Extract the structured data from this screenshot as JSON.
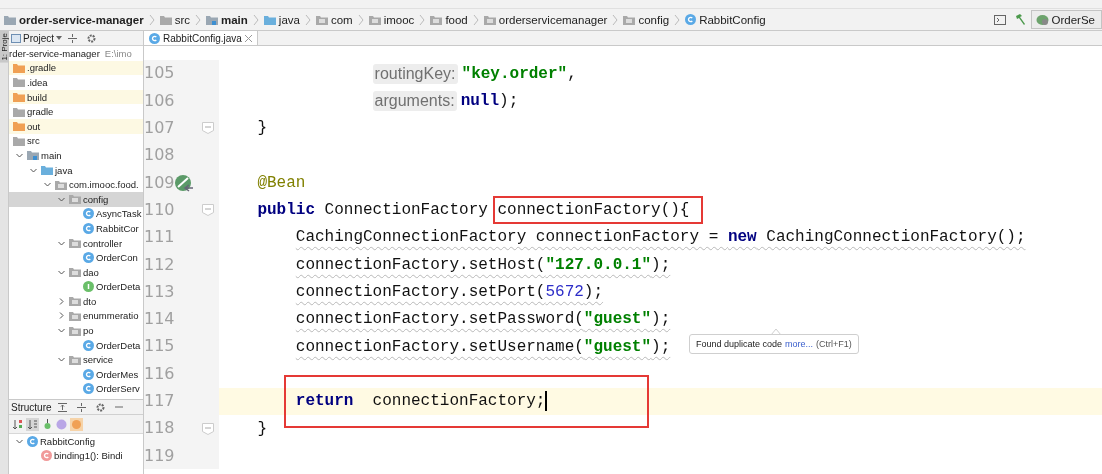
{
  "breadcrumbs": [
    {
      "label": "order-service-manager",
      "kind": "module",
      "bold": true
    },
    {
      "label": "src",
      "kind": "folder",
      "bold": false
    },
    {
      "label": "main",
      "kind": "source",
      "bold": true
    },
    {
      "label": "java",
      "kind": "java",
      "bold": false
    },
    {
      "label": "com",
      "kind": "package",
      "bold": false
    },
    {
      "label": "imooc",
      "kind": "package",
      "bold": false
    },
    {
      "label": "food",
      "kind": "package",
      "bold": false
    },
    {
      "label": "orderservicemanager",
      "kind": "package",
      "bold": false
    },
    {
      "label": "config",
      "kind": "package",
      "bold": false
    },
    {
      "label": "RabbitConfig",
      "kind": "class",
      "bold": false
    }
  ],
  "run_config": {
    "label": "OrderSe"
  },
  "side_strip": {
    "label": "1: Proje"
  },
  "project_panel": {
    "title": "Project",
    "root": {
      "label": "rder-service-manager",
      "path": "E:\\imo"
    },
    "tree": [
      {
        "label": ".gradle",
        "kind": "excluded",
        "selected": false
      },
      {
        "label": ".idea",
        "kind": "folder",
        "selected": false
      },
      {
        "label": "build",
        "kind": "excluded",
        "selected": false
      },
      {
        "label": "gradle",
        "kind": "folder",
        "selected": false
      },
      {
        "label": "out",
        "kind": "excluded",
        "selected": false
      },
      {
        "label": "src",
        "kind": "folder",
        "selected": false,
        "children": [
          {
            "label": "main",
            "kind": "source",
            "selected": false,
            "expanded": true,
            "children": [
              {
                "label": "java",
                "kind": "java",
                "selected": false,
                "expanded": true,
                "children": [
                  {
                    "label": "com.imooc.food.",
                    "kind": "package",
                    "selected": false,
                    "expanded": true,
                    "children": [
                      {
                        "label": "config",
                        "kind": "package",
                        "selected": true,
                        "expanded": true,
                        "children": [
                          {
                            "label": "AsyncTask",
                            "kind": "class",
                            "selected": false
                          },
                          {
                            "label": "RabbitCor",
                            "kind": "class",
                            "selected": false
                          }
                        ]
                      },
                      {
                        "label": "controller",
                        "kind": "package",
                        "selected": false,
                        "expanded": true,
                        "children": [
                          {
                            "label": "OrderCon",
                            "kind": "class",
                            "selected": false
                          }
                        ]
                      },
                      {
                        "label": "dao",
                        "kind": "package",
                        "selected": false,
                        "expanded": true,
                        "children": [
                          {
                            "label": "OrderDeta",
                            "kind": "interface",
                            "selected": false
                          }
                        ]
                      },
                      {
                        "label": "dto",
                        "kind": "package",
                        "selected": false,
                        "expanded": false
                      },
                      {
                        "label": "enummeratio",
                        "kind": "package",
                        "selected": false,
                        "expanded": false
                      },
                      {
                        "label": "po",
                        "kind": "package",
                        "selected": false,
                        "expanded": true,
                        "children": [
                          {
                            "label": "OrderDeta",
                            "kind": "class",
                            "selected": false
                          }
                        ]
                      },
                      {
                        "label": "service",
                        "kind": "package",
                        "selected": false,
                        "expanded": true,
                        "children": [
                          {
                            "label": "OrderMes",
                            "kind": "class",
                            "selected": false
                          },
                          {
                            "label": "OrderServ",
                            "kind": "class",
                            "selected": false
                          }
                        ]
                      }
                    ]
                  }
                ]
              }
            ]
          }
        ]
      }
    ]
  },
  "structure_panel": {
    "title": "Structure",
    "tree": [
      {
        "label": "RabbitConfig",
        "kind": "class",
        "expanded": true,
        "children": [
          {
            "label": "binding1(): Bindi",
            "kind": "method"
          }
        ]
      }
    ]
  },
  "editor": {
    "tab": {
      "label": "RabbitConfig.java",
      "selected": true
    },
    "lines": [
      {
        "number": "105",
        "kind": "argument",
        "tokens": [
          {
            "kind": "hint",
            "text": "routingKey:"
          },
          {
            "kind": "string",
            "text": "\"key.order\""
          },
          {
            "kind": "plain",
            "text": ","
          }
        ]
      },
      {
        "number": "106",
        "kind": "argument",
        "tokens": [
          {
            "kind": "hint",
            "text": "arguments:"
          },
          {
            "kind": "keyword",
            "text": "null"
          },
          {
            "kind": "plain",
            "text": ");"
          }
        ]
      },
      {
        "number": "107",
        "kind": "member",
        "fold": true,
        "tokens": [
          {
            "kind": "plain",
            "text": "}"
          }
        ]
      },
      {
        "number": "108"
      },
      {
        "number": "109",
        "kind": "member",
        "bean": true,
        "tokens": [
          {
            "kind": "annotation",
            "text": "@Bean"
          }
        ]
      },
      {
        "number": "110",
        "kind": "member",
        "fold": true,
        "tokens": [
          {
            "kind": "keyword",
            "text": "public"
          },
          {
            "kind": "plain",
            "text": " ConnectionFactory "
          },
          {
            "kind": "plain",
            "text": "connectionFactory(){",
            "framed": true
          }
        ]
      },
      {
        "number": "111",
        "kind": "body",
        "warning": true,
        "tokens": [
          {
            "kind": "plain",
            "text": "CachingConnectionFactory connectionFactory = "
          },
          {
            "kind": "keyword",
            "text": "new"
          },
          {
            "kind": "plain",
            "text": " CachingConnectionFactory();"
          }
        ]
      },
      {
        "number": "112",
        "kind": "body",
        "warning": true,
        "tokens": [
          {
            "kind": "plain",
            "text": "connectionFactory.setHost("
          },
          {
            "kind": "string",
            "text": "\"127.0.0.1\""
          },
          {
            "kind": "plain",
            "text": ");"
          }
        ]
      },
      {
        "number": "113",
        "kind": "body",
        "warning": true,
        "tokens": [
          {
            "kind": "plain",
            "text": "connectionFactory.setPort("
          },
          {
            "kind": "number",
            "text": "5672"
          },
          {
            "kind": "plain",
            "text": ");"
          }
        ]
      },
      {
        "number": "114",
        "kind": "body",
        "warning": true,
        "tokens": [
          {
            "kind": "plain",
            "text": "connectionFactory.setPassword("
          },
          {
            "kind": "string",
            "text": "\"guest\""
          },
          {
            "kind": "plain",
            "text": ");"
          }
        ]
      },
      {
        "number": "115",
        "kind": "body",
        "warning": true,
        "tokens": [
          {
            "kind": "plain",
            "text": "connectionFactory.setUsername("
          },
          {
            "kind": "string",
            "text": "\"guest\""
          },
          {
            "kind": "plain",
            "text": ");"
          }
        ]
      },
      {
        "number": "116"
      },
      {
        "number": "117",
        "kind": "body",
        "current": true,
        "caret": true,
        "framed": true,
        "tokens": [
          {
            "kind": "keyword",
            "text": "return"
          },
          {
            "kind": "plain",
            "text": "  connectionFactory;"
          }
        ]
      },
      {
        "number": "118",
        "kind": "member",
        "fold": true,
        "tokens": [
          {
            "kind": "plain",
            "text": "}"
          }
        ]
      },
      {
        "number": "119"
      }
    ],
    "tooltip": {
      "text": "Found duplicate code",
      "link": "more...",
      "shortcut": "(Ctrl+F1)"
    }
  }
}
